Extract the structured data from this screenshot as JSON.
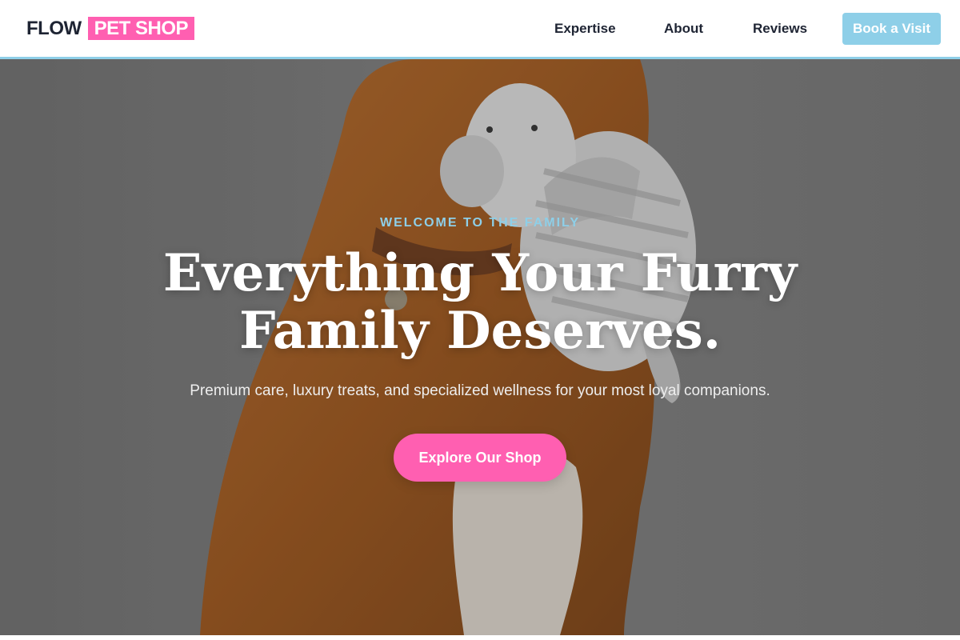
{
  "header": {
    "logo": {
      "primary": "FLOW",
      "highlight": "PET SHOP"
    },
    "nav": [
      {
        "label": "Expertise"
      },
      {
        "label": "About"
      },
      {
        "label": "Reviews"
      }
    ],
    "cta_label": "Book a Visit"
  },
  "hero": {
    "eyebrow": "WELCOME TO THE FAMILY",
    "title_line1": "Everything Your Furry",
    "title_line2": "Family Deserves.",
    "subtitle": "Premium care, luxury treats, and specialized wellness for your most loyal companions.",
    "cta_label": "Explore Our Shop",
    "image": "dog-with-plush-elephant-toy"
  },
  "colors": {
    "accent_pink": "#ff5fb1",
    "accent_blue": "#8ecfe8",
    "text_dark": "#1e2433",
    "white": "#ffffff"
  }
}
